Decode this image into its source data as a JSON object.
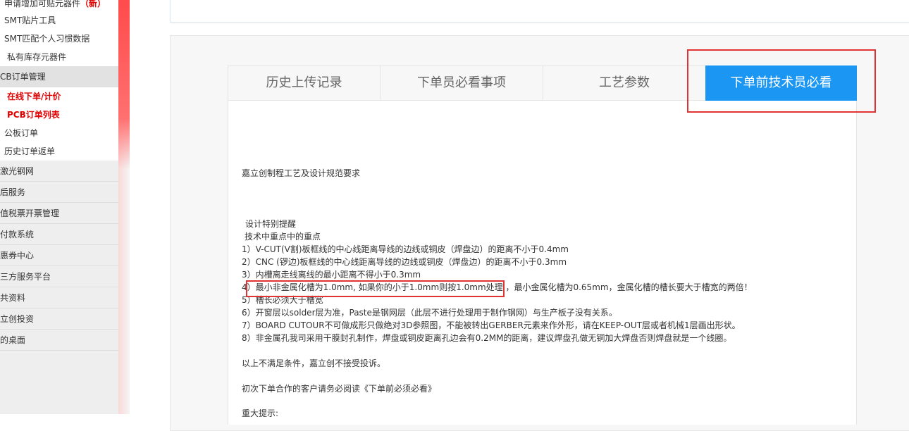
{
  "sidebar": {
    "top_items": [
      {
        "label": "申请增加可贴元器件",
        "tag": "（新）"
      },
      {
        "label": "SMT贴片工具"
      },
      {
        "label": "SMT匹配个人习惯数据"
      },
      {
        "label": "私有库存元器件"
      }
    ],
    "pcb_category": "CB订单管理",
    "pcb_items": [
      {
        "label": "在线下单/计价"
      },
      {
        "label": "PCB订单列表"
      },
      {
        "label": "公板订单"
      },
      {
        "label": "历史订单返单"
      }
    ],
    "categories": [
      "激光钢网",
      "后服务",
      "值税票开票管理",
      "付款系统",
      "惠券中心",
      "三方服务平台",
      "共资料",
      "立创投资",
      "的桌面"
    ]
  },
  "tabs": [
    {
      "label": "历史上传记录"
    },
    {
      "label": "下单员必看事项"
    },
    {
      "label": "工艺参数"
    },
    {
      "label": "下单前技术员必看"
    }
  ],
  "content": {
    "title": "嘉立创制程工艺及设计规范要求",
    "heading1": "设计特别提醒",
    "heading2": "技术中重点中的重点",
    "items": [
      "1）V-CUT(V割)板框线的中心线距离导线的边线或铜皮（焊盘边）的距离不小于0.4mm",
      "2）CNC (锣边)板框线的中心线距离导线的边线或铜皮（焊盘边）的距离不小于0.3mm",
      "3）内槽离走线离线的最小距离不得小于0.3mm",
      "4）最小非金属化槽为1.0mm, 如果你的小于1.0mm则按1.0mm处理 ，最小金属化槽为0.65mm，金属化槽的槽长要大于槽宽的两倍！",
      "5）槽长必须大于槽宽",
      "6）开窗层以solder层为准，Paste是钢网层（此层不进行处理用于制作钢网）与生产板子没有关系。",
      "7）BOARD CUTOUR不可做成形只做绝对3D参照图，不能被转出GERBER元素来作外形，请在KEEP-OUT层或者机械1层画出形状。",
      "8）非金属孔我司采用干膜封孔制作，焊盘或铜皮距离孔边会有0.2MM的距离，建议焊盘孔做无铜加大焊盘否则焊盘就是一个线圈。"
    ],
    "notice1": "以上不满足条件，嘉立创不接受投诉。",
    "notice2": "初次下单合作的客户请务必阅读《下单前必须必看》",
    "notice3": "重大提示:"
  },
  "colors": {
    "accent": "#1b96f3",
    "active_red": "#e00000",
    "annotation_red": "#e03434"
  }
}
